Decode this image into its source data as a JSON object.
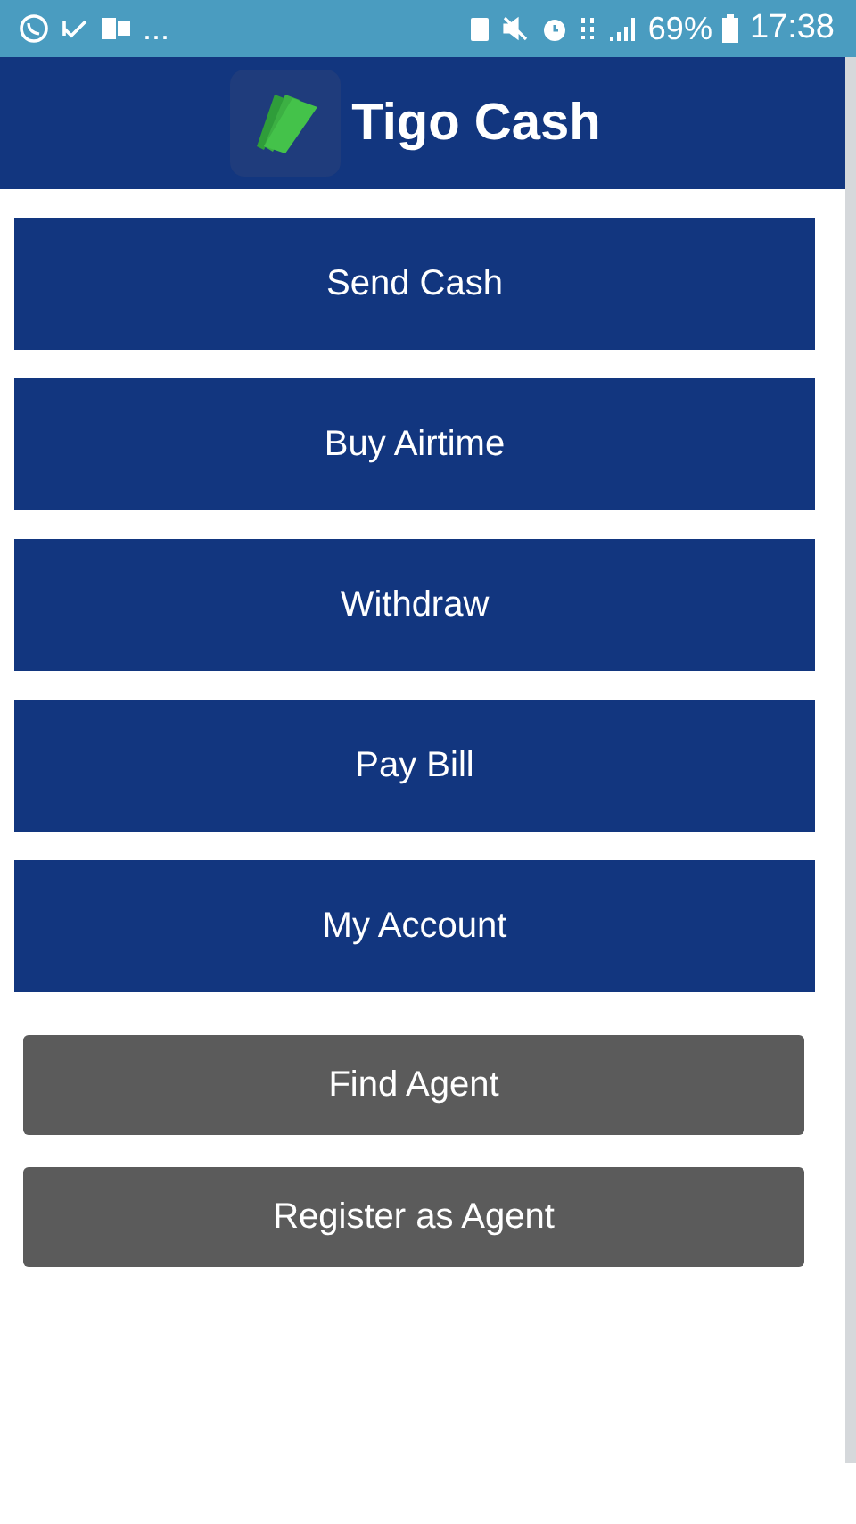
{
  "status_bar": {
    "overflow": "...",
    "battery": "69%",
    "time": "17:38"
  },
  "app_bar": {
    "title": "Tigo Cash"
  },
  "buttons": [
    {
      "label": "Send Cash",
      "kind": "primary"
    },
    {
      "label": "Buy Airtime",
      "kind": "primary"
    },
    {
      "label": "Withdraw",
      "kind": "primary"
    },
    {
      "label": "Pay Bill",
      "kind": "primary"
    },
    {
      "label": "My Account",
      "kind": "primary"
    },
    {
      "label": "Find Agent",
      "kind": "secondary"
    },
    {
      "label": "Register as Agent",
      "kind": "secondary"
    }
  ]
}
